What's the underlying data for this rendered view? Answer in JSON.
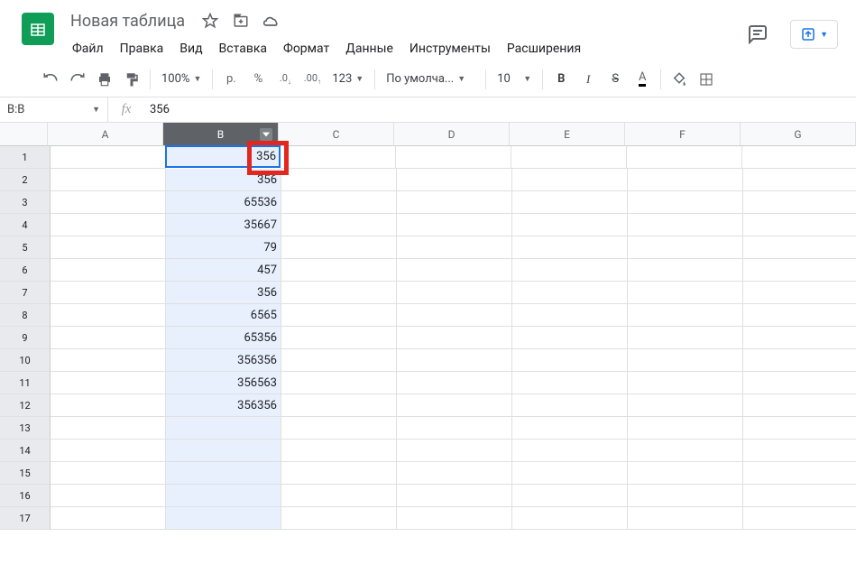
{
  "header": {
    "title": "Новая таблица"
  },
  "menu": {
    "file": "Файл",
    "edit": "Правка",
    "view": "Вид",
    "insert": "Вставка",
    "format": "Формат",
    "data": "Данные",
    "tools": "Инструменты",
    "extensions": "Расширения"
  },
  "toolbar": {
    "zoom": "100%",
    "currency": "р.",
    "percent": "%",
    "dec_dec": ".0",
    "dec_inc": ".00",
    "more_formats": "123",
    "font": "По умолча...",
    "font_size": "10",
    "bold": "B",
    "italic": "I",
    "strike": "S",
    "text_color": "A"
  },
  "name_box": "B:B",
  "formula": "356",
  "columns": [
    "A",
    "B",
    "C",
    "D",
    "E",
    "F",
    "G"
  ],
  "rows": [
    "1",
    "2",
    "3",
    "4",
    "5",
    "6",
    "7",
    "8",
    "9",
    "10",
    "11",
    "12",
    "13",
    "14",
    "15",
    "16",
    "17"
  ],
  "selected_column": "B",
  "active_cell_row": 0,
  "chart_data": {
    "type": "table",
    "columns": [
      "A",
      "B",
      "C",
      "D",
      "E",
      "F",
      "G"
    ],
    "data": {
      "B": [
        "356",
        "356",
        "65536",
        "35667",
        "79",
        "457",
        "356",
        "6565",
        "65356",
        "356356",
        "356563",
        "356356",
        "",
        "",
        "",
        "",
        ""
      ]
    }
  }
}
